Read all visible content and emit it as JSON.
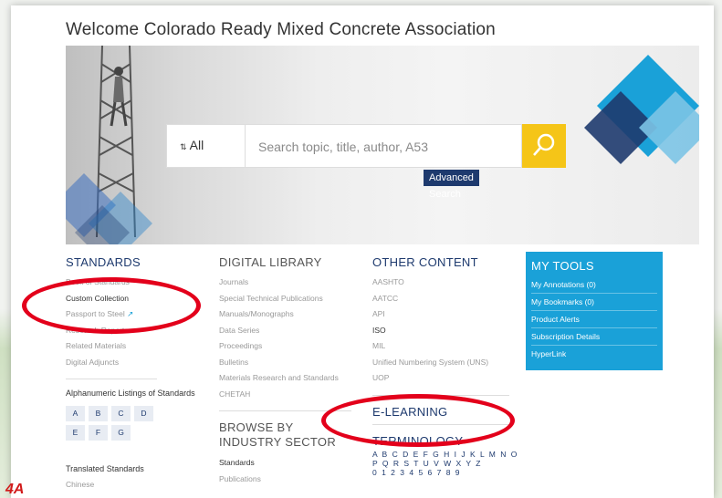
{
  "welcome_text": "Welcome Colorado Ready Mixed Concrete Association",
  "search": {
    "scope_label": "All",
    "placeholder": "Search topic, title, author, A53",
    "advanced_label": "Advanced Search"
  },
  "standards": {
    "title": "STANDARDS",
    "items": [
      "Book of Standards",
      "Custom Collection",
      "Passport to Steel",
      "Research Reports",
      "Related Materials",
      "Digital Adjuncts"
    ],
    "alpha_label": "Alphanumeric Listings of Standards",
    "alpha_letters": [
      "A",
      "B",
      "C",
      "D",
      "E",
      "F",
      "G"
    ],
    "translated_label": "Translated Standards",
    "translated_items": [
      "Chinese"
    ]
  },
  "digital_library": {
    "title": "DIGITAL LIBRARY",
    "items": [
      "Journals",
      "Special Technical Publications",
      "Manuals/Monographs",
      "Data Series",
      "Proceedings",
      "Bulletins",
      "Materials Research and Standards",
      "CHETAH"
    ]
  },
  "browse_by_industry": {
    "title": "BROWSE BY INDUSTRY SECTOR",
    "items": [
      "Standards",
      "Publications"
    ]
  },
  "other_content": {
    "title": "OTHER CONTENT",
    "items": [
      "AASHTO",
      "AATCC",
      "API",
      "ISO",
      "MIL",
      "Unified Numbering System (UNS)",
      "UOP"
    ]
  },
  "elearning": {
    "title": "E-LEARNING"
  },
  "terminology": {
    "title": "TERMINOLOGY",
    "row1": "A B C D E F G H I J K L M N O",
    "row2": "P Q R S T U V W X Y Z",
    "row3": "0 1 2 3 4 5 6 7 8 9"
  },
  "my_tools": {
    "title": "MY TOOLS",
    "items": [
      "My Annotations (0)",
      "My Bookmarks (0)",
      "Product Alerts",
      "Subscription Details",
      "HyperLink"
    ]
  },
  "slide_label": "4A",
  "colors": {
    "navy": "#1e3a6e",
    "accent_blue": "#1aa1d8",
    "search_yellow": "#f5c518",
    "annotation_red": "#e3001b"
  }
}
